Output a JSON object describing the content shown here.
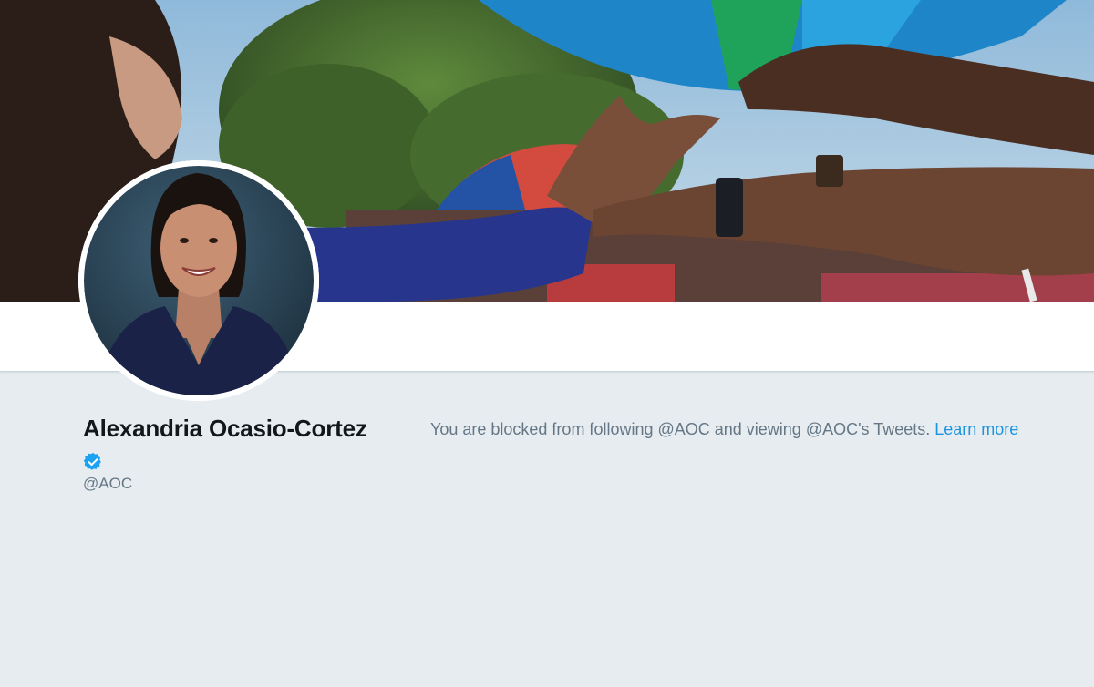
{
  "profile": {
    "name": "Alexandria Ocasio-Cortez",
    "handle": "@AOC",
    "verified": true
  },
  "blocked_notice": {
    "message": "You are blocked from following @AOC and viewing @AOC's Tweets.",
    "learn_more_label": "Learn more"
  },
  "icons": {
    "verified": "verified-badge-icon"
  },
  "colors": {
    "background": "#e6ecf0",
    "link": "#1b95e0",
    "verified_badge": "#1da1f2",
    "primary_text": "#14171a",
    "secondary_text": "#657786"
  }
}
